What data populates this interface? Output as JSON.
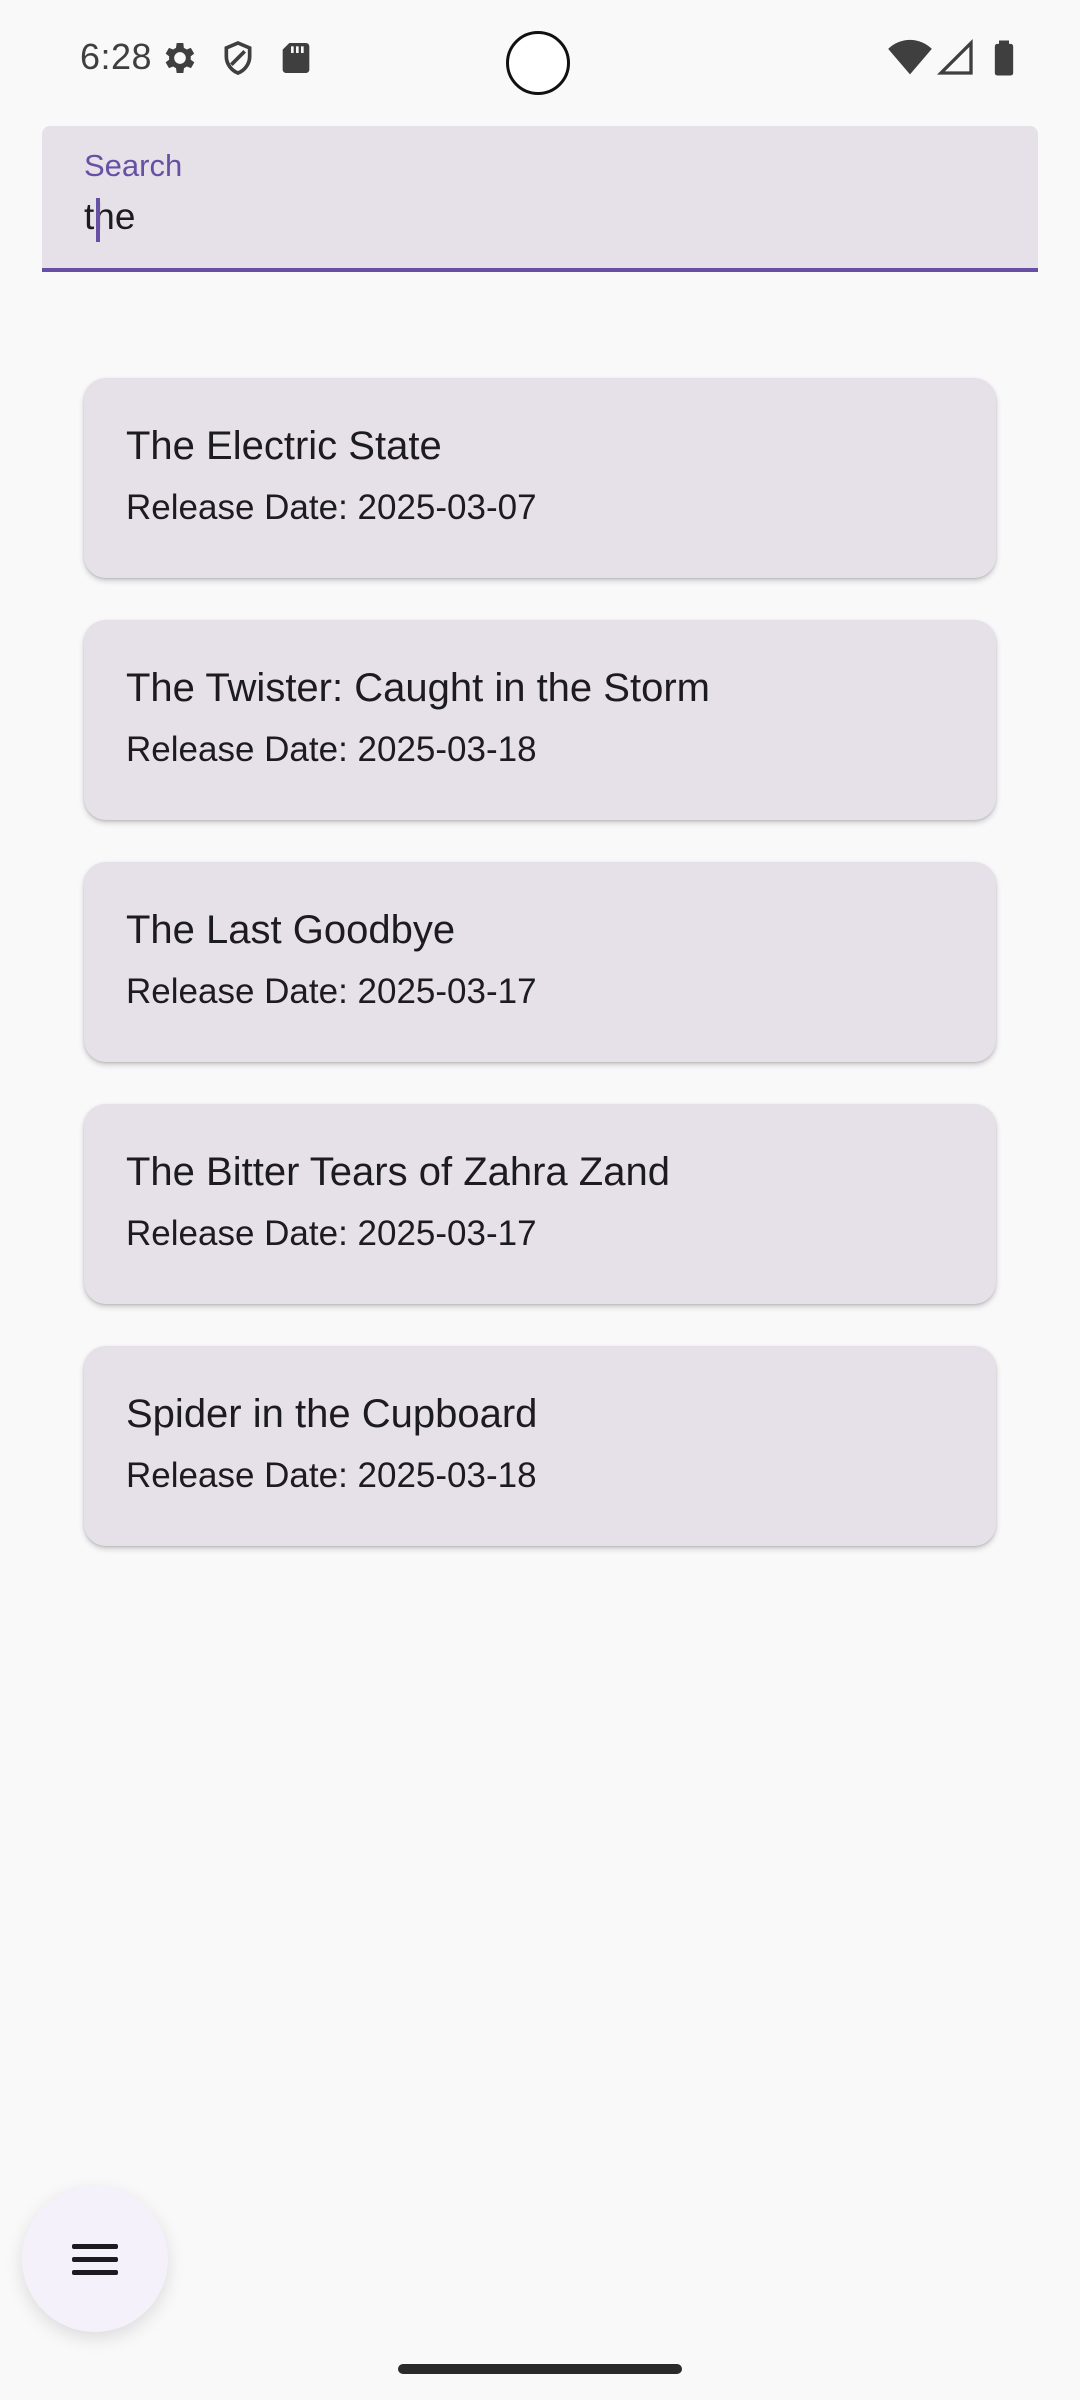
{
  "status_bar": {
    "time": "6:28",
    "left_icons": [
      "gear-icon",
      "shield-icon",
      "sd-card-icon"
    ],
    "right_icons": [
      "wifi-icon",
      "cell-signal-icon",
      "battery-icon"
    ]
  },
  "search": {
    "label": "Search",
    "value": "the",
    "accent_color": "#6750a4"
  },
  "results": [
    {
      "title": "The Electric State",
      "date": "Release Date: 2025-03-07"
    },
    {
      "title": "The Twister: Caught in the Storm",
      "date": "Release Date: 2025-03-18"
    },
    {
      "title": "The Last Goodbye",
      "date": "Release Date: 2025-03-17"
    },
    {
      "title": "The Bitter Tears of Zahra Zand",
      "date": "Release Date: 2025-03-17"
    },
    {
      "title": "Spider in the Cupboard",
      "date": "Release Date: 2025-03-18"
    }
  ],
  "fab": {
    "icon": "menu-icon"
  }
}
